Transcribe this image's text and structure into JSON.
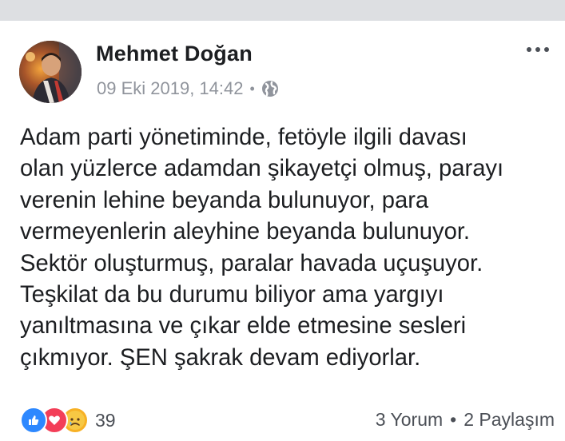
{
  "post": {
    "author": "Mehmet Doğan",
    "timestamp": "09 Eki 2019, 14:42",
    "separator": "•",
    "privacy_icon": "globe-icon",
    "more_icon": "more-horizontal-icon",
    "text": "Adam parti yönetiminde, fetöyle ilgili davası\nolan yüzlerce adamdan şikayetçi olmuş, parayı\nverenin lehine beyanda bulunuyor, para\nvermeyenlerin aleyhine beyanda bulunuyor.\nSektör oluşturmuş, paralar havada uçuşuyor.\nTeşkilat da bu durumu biliyor ama yargıyı\nyanıltmasına ve çıkar elde etmesine sesleri\nçıkmıyor. ŞEN şakrak devam ediyorlar."
  },
  "reactions": {
    "types": [
      "like-icon",
      "love-icon",
      "sad-icon"
    ],
    "count": "39"
  },
  "stats": {
    "comments": "3 Yorum",
    "separator": "•",
    "shares": "2 Paylaşım"
  },
  "colors": {
    "like": "#2d88ff",
    "love": "#f33e58",
    "sad": "#f7b125",
    "meta_gray": "#90949c",
    "text": "#1c1e21"
  }
}
